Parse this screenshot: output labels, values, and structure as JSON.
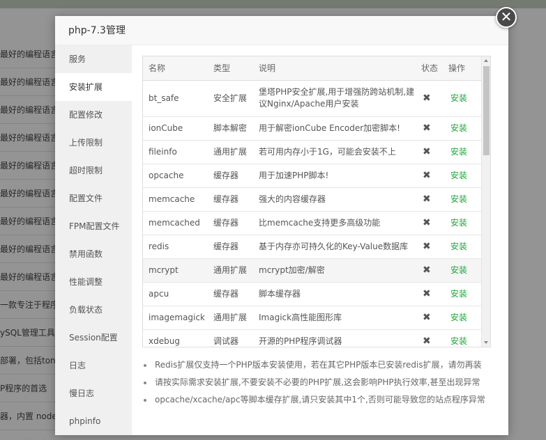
{
  "background": {
    "rows": [
      "最好的编程语言",
      "最好的编程语言",
      "最好的编程语言",
      "最好的编程语言",
      "最好的编程语言",
      "最好的编程语言",
      "最好的编程语言",
      "最好的编程语言",
      "最好的编程语言",
      "一款专注于程序(",
      "ySQL管理工具",
      "部署，包括ton",
      "P程序的首选",
      "器，内置 node.",
      "P程序的首选"
    ]
  },
  "modal": {
    "title": "php-7.3管理",
    "close_label": "✕"
  },
  "sidebar": {
    "items": [
      {
        "label": "服务"
      },
      {
        "label": "安装扩展"
      },
      {
        "label": "配置修改"
      },
      {
        "label": "上传限制"
      },
      {
        "label": "超时限制"
      },
      {
        "label": "配置文件"
      },
      {
        "label": "FPM配置文件"
      },
      {
        "label": "禁用函数"
      },
      {
        "label": "性能调整"
      },
      {
        "label": "负载状态"
      },
      {
        "label": "Session配置"
      },
      {
        "label": "日志"
      },
      {
        "label": "慢日志"
      },
      {
        "label": "phpinfo"
      }
    ],
    "active_index": 1
  },
  "table": {
    "headers": [
      "名称",
      "类型",
      "说明",
      "状态",
      "操作"
    ],
    "rows": [
      {
        "name": "bt_safe",
        "type": "安全扩展",
        "desc": "堡塔PHP安全扩展,用于增强防跨站机制,建议Nginx/Apache用户安装",
        "status": "✖",
        "action": "安装"
      },
      {
        "name": "ionCube",
        "type": "脚本解密",
        "desc": "用于解密ionCube Encoder加密脚本!",
        "status": "✖",
        "action": "安装"
      },
      {
        "name": "fileinfo",
        "type": "通用扩展",
        "desc": "若可用内存小于1G，可能会安装不上",
        "status": "✖",
        "action": "安装"
      },
      {
        "name": "opcache",
        "type": "缓存器",
        "desc": "用于加速PHP脚本!",
        "status": "✖",
        "action": "安装"
      },
      {
        "name": "memcache",
        "type": "缓存器",
        "desc": "强大的内容缓存器",
        "status": "✖",
        "action": "安装"
      },
      {
        "name": "memcached",
        "type": "缓存器",
        "desc": "比memcache支持更多高级功能",
        "status": "✖",
        "action": "安装"
      },
      {
        "name": "redis",
        "type": "缓存器",
        "desc": "基于内存亦可持久化的Key-Value数据库",
        "status": "✖",
        "action": "安装"
      },
      {
        "name": "mcrypt",
        "type": "通用扩展",
        "desc": "mcrypt加密/解密",
        "status": "✖",
        "action": "安装"
      },
      {
        "name": "apcu",
        "type": "缓存器",
        "desc": "脚本缓存器",
        "status": "✖",
        "action": "安装"
      },
      {
        "name": "imagemagick",
        "type": "通用扩展",
        "desc": "Imagick高性能图形库",
        "status": "✖",
        "action": "安装"
      },
      {
        "name": "xdebug",
        "type": "调试器",
        "desc": "开源的PHP程序调试器",
        "status": "✖",
        "action": "安装"
      }
    ],
    "highlighted_index": 7
  },
  "tips": [
    "Redis扩展仅支持一个PHP版本安装使用，若在其它PHP版本已安装redis扩展，请勿再装",
    "请按实际需求安装扩展,不要安装不必要的PHP扩展,这会影响PHP执行效率,甚至出现异常",
    "opcache/xcache/apc等脚本缓存扩展,请只安装其中1个,否则可能导致您的站点程序异常"
  ],
  "colors": {
    "accent_green": "#20a53a",
    "overlay": "rgba(0,0,0,0.42)"
  }
}
